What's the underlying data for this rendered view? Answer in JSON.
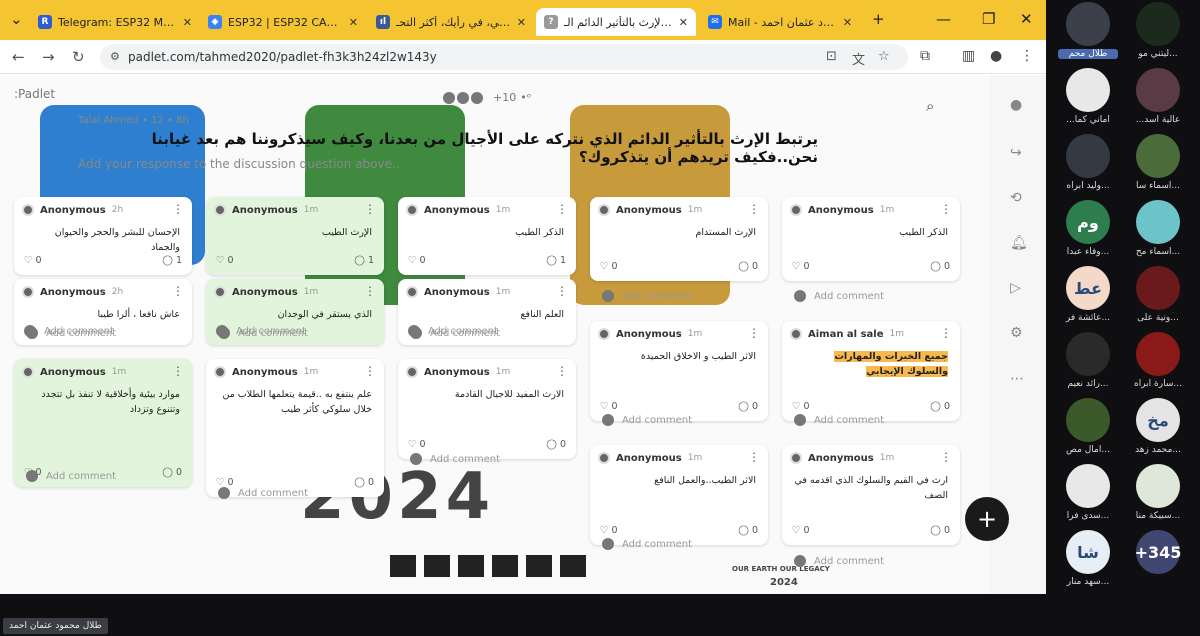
{
  "tabs": [
    {
      "title": "Telegram: ESP32 Motion",
      "fav_color": "#2f5bd3",
      "fav_glyph": "R"
    },
    {
      "title": "ESP32 | ESP32 CAM Take",
      "fav_color": "#3b82f6",
      "fav_glyph": "◆"
    },
    {
      "title": "ما هي، في رأيك، أكثر التحـ",
      "fav_color": "#3b5998",
      "fav_glyph": "ıl"
    },
    {
      "title": "يرتبط الإرث بالتأثير الدائم الـ",
      "fav_color": "#999999",
      "fav_glyph": "?"
    },
    {
      "title": "Mail - محمود عثمان احمد",
      "fav_color": "#1f6feb",
      "fav_glyph": "✉"
    }
  ],
  "url": "padlet.com/tahmed2020/padlet-fh3k3h24zl2w143y",
  "padlet": {
    "logo": ":Padlet",
    "visitors": "+10",
    "author_line": "Talal Ahmed • 12 • 8h",
    "question": "يرتبط الإرث بالتأثير الدائم الذي نتركه على الأجيال من بعدنا، وكيف سيذكروننا هم بعد غيابنا نحن..فكيف تريدهم أن يتذكروك؟",
    "placeholder": "Add your response to the discussion question above..",
    "add_comment": "Add comment",
    "legacy_text": "OUR EARTH OUR LEGACY",
    "legacy_year": "2024",
    "wall_year": "2024"
  },
  "cards": [
    {
      "author": "Anonymous",
      "time": "2h",
      "text": "الإحسان للبشر والحجر والحيوان والجماد",
      "likes": "0",
      "comments": "1",
      "green": false
    },
    {
      "author": "Anonymous",
      "time": "2h",
      "text": "عاش نافعا ، ألرا طيبا",
      "likes": "",
      "comments": "",
      "green": false
    },
    {
      "author": "Anonymous",
      "time": "1m",
      "text": "موارد بيئية وأخلاقية لا تنفذ بل تتجدد وتتنوع وتزداد",
      "likes": "0",
      "comments": "0",
      "green": true
    },
    {
      "author": "Anonymous",
      "time": "1m",
      "text": "الإرث الطيب",
      "likes": "0",
      "comments": "1",
      "green": true
    },
    {
      "author": "Anonymous",
      "time": "1m",
      "text": "الذي يستقر في الوجدان",
      "likes": "",
      "comments": "",
      "green": true
    },
    {
      "author": "Anonymous",
      "time": "1m",
      "text": "علم ينتفع به ..قيمة يتعلمها الطلاب من خلال سلوكي كأثر طيب",
      "likes": "0",
      "comments": "0",
      "green": false
    },
    {
      "author": "Anonymous",
      "time": "1m",
      "text": "الذكر الطيب",
      "likes": "0",
      "comments": "1",
      "green": false
    },
    {
      "author": "Anonymous",
      "time": "1m",
      "text": "العلم النافع",
      "likes": "",
      "comments": "",
      "green": false
    },
    {
      "author": "Anonymous",
      "time": "1m",
      "text": "الارث المفيد للاجيال القادمة",
      "likes": "0",
      "comments": "0",
      "green": false
    },
    {
      "author": "Anonymous",
      "time": "1m",
      "text": "الإرث المستدام",
      "likes": "0",
      "comments": "0",
      "green": false
    },
    {
      "author": "Anonymous",
      "time": "1m",
      "text": "الاثر الطيب و الاخلاق الحميدة",
      "likes": "0",
      "comments": "0",
      "green": false
    },
    {
      "author": "Anonymous",
      "time": "1m",
      "text": "الاثر الطيب..والعمل النافع",
      "likes": "0",
      "comments": "0",
      "green": false
    },
    {
      "author": "Anonymous",
      "time": "1m",
      "text": "الذكر الطيب",
      "likes": "0",
      "comments": "0",
      "green": false
    },
    {
      "author": "Aiman al sale",
      "time": "1m",
      "text": "جميع الخبرات والمهارات والسلوك الإيجابي",
      "likes": "0",
      "comments": "0",
      "green": false
    },
    {
      "author": "Anonymous",
      "time": "1m",
      "text": "ارث في القيم والسلوك الذي اقدمه في الصف",
      "likes": "0",
      "comments": "0",
      "green": false
    }
  ],
  "participants": [
    {
      "name": "طلال محم",
      "color": "#3a3f4a",
      "glyph": "",
      "highlight": true
    },
    {
      "name": "...ليتني مو",
      "color": "#1c2a1e",
      "glyph": "",
      "highlight": false
    },
    {
      "name": "اماني كما...",
      "color": "#e8e8e8",
      "glyph": "",
      "highlight": false
    },
    {
      "name": "عالية اسد...",
      "color": "#5a3a44",
      "glyph": "",
      "highlight": false
    },
    {
      "name": "...وليد ابراه",
      "color": "#333a44",
      "glyph": "",
      "highlight": false
    },
    {
      "name": "...اسماء سا",
      "color": "#4a6b3a",
      "glyph": "",
      "highlight": false
    },
    {
      "name": "...وفاء عبدا",
      "color": "#2e7d4f",
      "glyph": "وم",
      "highlight": false
    },
    {
      "name": "...اسماء مح",
      "color": "#6cc4c9",
      "glyph": "",
      "highlight": false
    },
    {
      "name": "...عائشة فر",
      "color": "#f5d9c8",
      "glyph": "عط",
      "highlight": false
    },
    {
      "name": "...ونية على",
      "color": "#6a1a1a",
      "glyph": "",
      "highlight": false
    },
    {
      "name": "...رائد نعيم",
      "color": "#2a2a2a",
      "glyph": "",
      "highlight": false
    },
    {
      "name": "...سارة ابراه",
      "color": "#8a1a1a",
      "glyph": "",
      "highlight": false
    },
    {
      "name": "...آمال مص",
      "color": "#3a5a2a",
      "glyph": "",
      "highlight": false
    },
    {
      "name": "...محمد زهد",
      "color": "#e4e4e4",
      "glyph": "مخ",
      "highlight": false
    },
    {
      "name": "...سدى فرا",
      "color": "#e8e8e8",
      "glyph": "",
      "highlight": false
    },
    {
      "name": "...سبيكة منا",
      "color": "#dfe8d8",
      "glyph": "",
      "highlight": false
    },
    {
      "name": "...سهد منار",
      "color": "#e8eef5",
      "glyph": "شا",
      "highlight": false
    },
    {
      "name": "",
      "color": "#3f4670",
      "glyph": "+345",
      "highlight": false
    }
  ],
  "speaker_name": "طلال محمود عثمان احمد"
}
